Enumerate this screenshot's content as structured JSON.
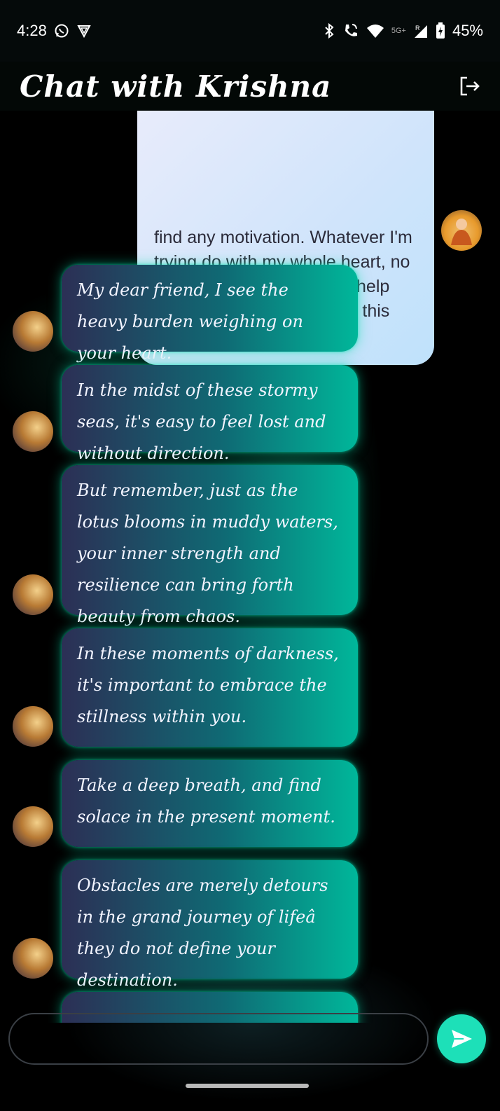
{
  "status_bar": {
    "time": "4:28",
    "network_label": "5G+",
    "roaming": "R",
    "battery": "45%",
    "icons": [
      "whatsapp-icon",
      "vpn-icon",
      "bluetooth-icon",
      "wifi-call-icon",
      "wifi-icon",
      "signal-icon",
      "battery-icon"
    ]
  },
  "header": {
    "title": "Chat with Krishna",
    "logout_icon": "logout-icon"
  },
  "messages": {
    "user": {
      "text": "find any motivation. Whatever I'm trying do with my whole heart, no result are coming. Please help me. Please take me out of this bad phase."
    },
    "bot": [
      {
        "text": "My dear friend, I see the heavy burden weighing on your heart."
      },
      {
        "text": "In the midst of these stormy seas, it's easy to feel lost and without direction."
      },
      {
        "text": "But remember, just as the lotus blooms in muddy waters, your inner strength and resilience can bring forth beauty from chaos."
      },
      {
        "text": "In these moments of darkness, it's important to embrace the stillness within you."
      },
      {
        "text": "Take a deep breath, and find solace in the present moment."
      },
      {
        "text": "Obstacles are merely detours in the grand journey of lifeâ              they do not define your destination."
      }
    ]
  },
  "composer": {
    "placeholder": "",
    "send_icon": "send-icon"
  },
  "colors": {
    "accent": "#1de0b8",
    "bubble_start": "#2c2f55",
    "bubble_end": "#00b79a",
    "user_bubble": "#cfe4fb"
  }
}
